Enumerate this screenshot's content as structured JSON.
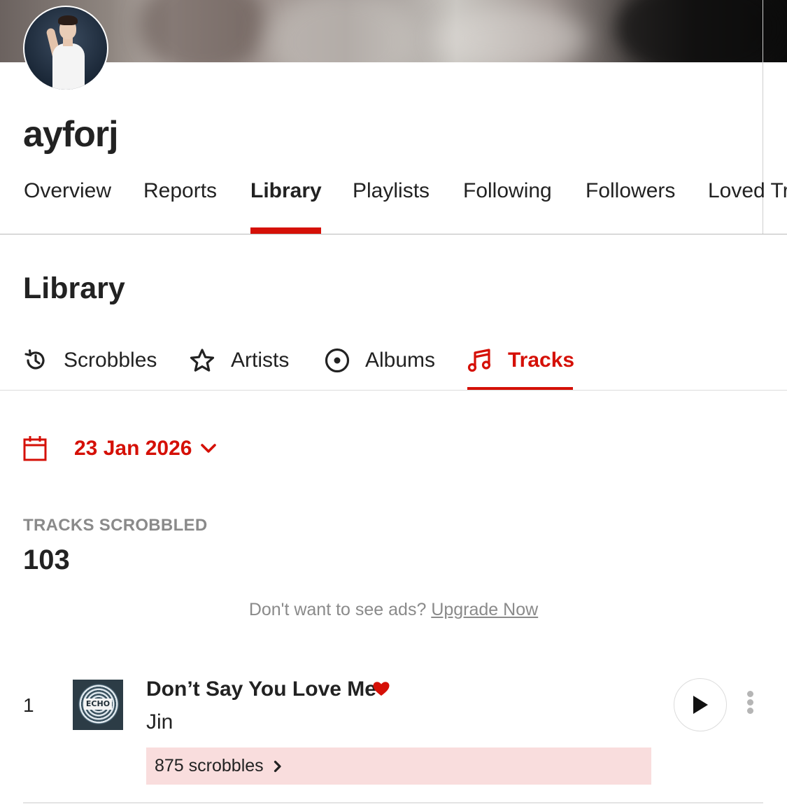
{
  "profile": {
    "username": "ayforj"
  },
  "main_nav": {
    "items": [
      {
        "label": "Overview",
        "active": false
      },
      {
        "label": "Reports",
        "active": false
      },
      {
        "label": "Library",
        "active": true
      },
      {
        "label": "Playlists",
        "active": false
      },
      {
        "label": "Following",
        "active": false
      },
      {
        "label": "Followers",
        "active": false
      },
      {
        "label": "Loved Tr",
        "active": false
      }
    ]
  },
  "library": {
    "title": "Library",
    "tabs": [
      {
        "label": "Scrobbles",
        "icon": "history-icon",
        "active": false
      },
      {
        "label": "Artists",
        "icon": "star-icon",
        "active": false
      },
      {
        "label": "Albums",
        "icon": "disc-icon",
        "active": false
      },
      {
        "label": "Tracks",
        "icon": "music-note-icon",
        "active": true
      }
    ],
    "date": "23 Jan 2026",
    "stat_label": "TRACKS SCROBBLED",
    "stat_value": "103",
    "ad_text": "Don't want to see ads?",
    "ad_link": "Upgrade Now"
  },
  "tracks": [
    {
      "rank": "1",
      "cover_text": "ECHO",
      "title": "Don’t Say You Love Me",
      "loved": true,
      "artist": "Jin",
      "scrobbles": "875 scrobbles"
    }
  ],
  "colors": {
    "accent": "#d51007",
    "scrobble_bar": "#f9dddd",
    "muted_text": "#8a8a8a"
  }
}
